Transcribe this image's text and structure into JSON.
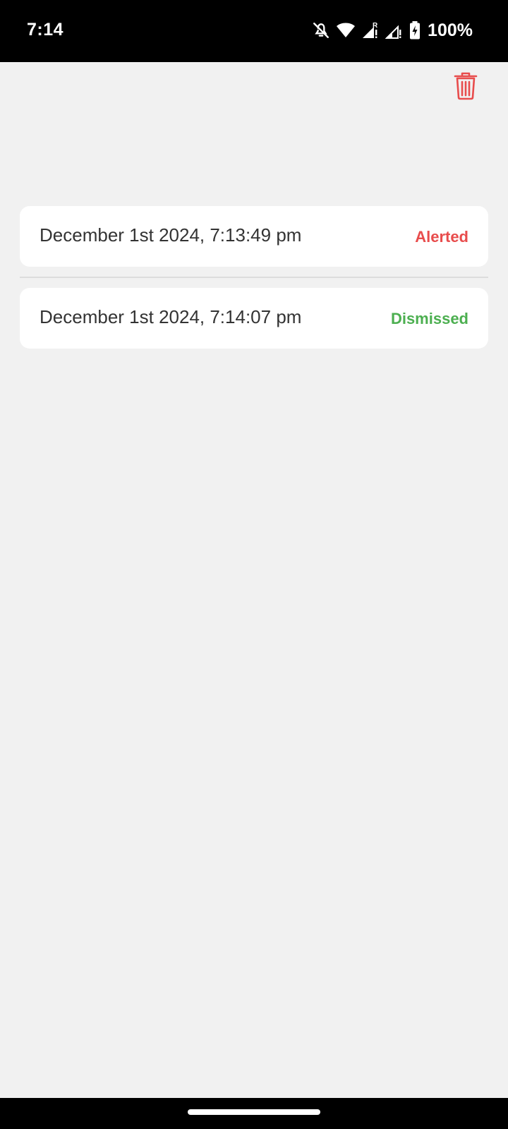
{
  "status_bar": {
    "time": "7:14",
    "battery": "100%",
    "icons": [
      "mute-icon",
      "wifi-icon",
      "signal-roaming-icon",
      "signal-icon",
      "battery-charging-icon"
    ]
  },
  "toolbar": {
    "delete_icon": "trash-icon",
    "accent_color": "#e84c4c"
  },
  "log": {
    "entries": [
      {
        "date": "December 1st 2024, 7:13:49 pm",
        "status": "Alerted",
        "status_color": "#e84c4c"
      },
      {
        "date": "December 1st 2024, 7:14:07 pm",
        "status": "Dismissed",
        "status_color": "#4caf50"
      }
    ]
  }
}
